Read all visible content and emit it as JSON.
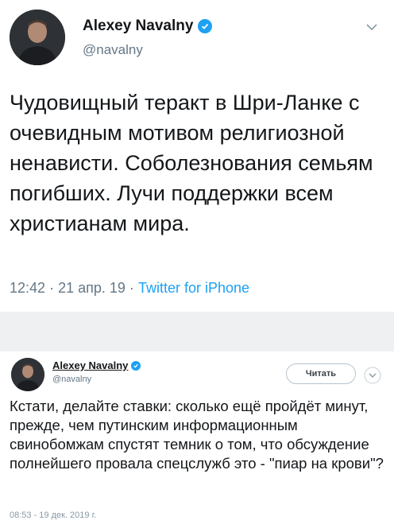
{
  "tweet1": {
    "author_name": "Alexey Navalny",
    "handle": "@navalny",
    "text": "Чудовищный теракт в Шри-Ланке с очевидным мотивом религиозной ненависти. Соболезнования семьям погибших. Лучи поддержки всем христианам мира.",
    "time": "12:42",
    "date": "21 апр. 19",
    "separator": "·",
    "source": "Twitter for iPhone",
    "icons": [
      "avatar",
      "verified-badge-icon",
      "chevron-down-icon"
    ]
  },
  "tweet2": {
    "author_name": "Alexey Navalny",
    "handle": "@navalny",
    "follow_button_label": "Читать",
    "text": "Кстати, делайте ставки: сколько ещё пройдёт минут, прежде, чем путинским информационным свинобомжам спустят темник о том, что обсуждение полнейшего провала спецслужб это - \"пиар на крови\"?",
    "meta": "08:53 - 19 дек. 2019 г.",
    "icons": [
      "avatar",
      "verified-badge-icon",
      "chevron-down-icon"
    ]
  },
  "colors": {
    "text": "#14171a",
    "secondary": "#657786",
    "link": "#1da1f2",
    "band": "#eef0f2"
  }
}
